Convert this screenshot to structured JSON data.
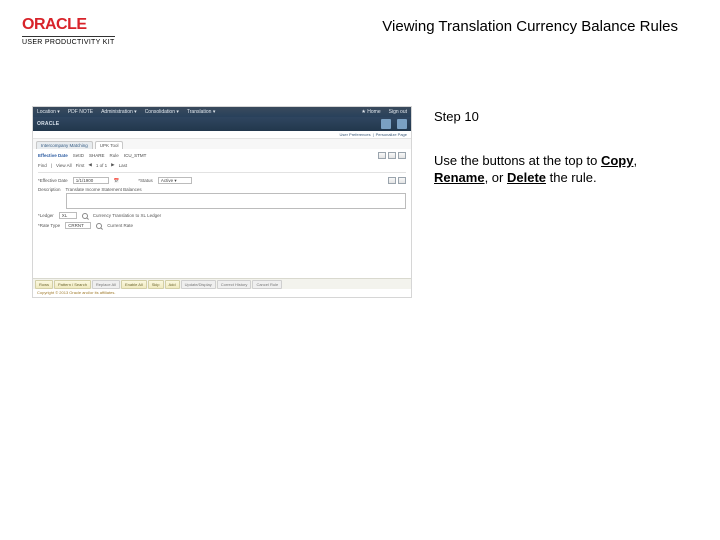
{
  "header": {
    "brand": "ORACLE",
    "subbrand": "USER PRODUCTIVITY KIT",
    "page_title": "Viewing Translation Currency Balance Rules"
  },
  "instructions": {
    "step_label": "Step 10",
    "line1_prefix": "Use the buttons at the top to ",
    "copy": "Copy",
    "comma1": ", ",
    "rename": "Rename",
    "comma2": ", or ",
    "delete": "Delete",
    "suffix": " the rule."
  },
  "shot": {
    "bar1": {
      "location_lbl": "Location ▾",
      "pdf": "PDF  NOTE",
      "admin": "Administration ▾",
      "consol": "Consolidation ▾",
      "trans": "Translation ▾",
      "home": "★ Home",
      "signout": "Sign out"
    },
    "bar2": {
      "brand": "ORACLE"
    },
    "subnav": {
      "user_prefs": "User Preferences",
      "personalize": "Personalize Page"
    },
    "tabs": {
      "t1": "Intercompany Matching",
      "t2": "UPK Tool"
    },
    "detail": {
      "effective_date": "Effective Date",
      "setid_lbl": "SetID",
      "setid_val": "SHARE",
      "rule_lbl": "Rule",
      "rule_val": "ICU_STMT",
      "find": "Find",
      "viewall": "View All",
      "first": "First",
      "pager": "1 of 1",
      "last": "Last",
      "effdate_lbl": "*Effective Date",
      "effdate_val": "1/1/1900",
      "cal_icon": "calendar-icon",
      "status_lbl": "*Status",
      "status_val": "Active ▾",
      "descr_lbl": "Description",
      "descr_val": "Translate Income Statement Balances",
      "ledger_lbl": "*Ledger",
      "ledger_val": "XL",
      "ledger_hint": "Currency Translation to XL Ledger",
      "rate_lbl": "*Rate Type",
      "rate_val": "CRRNT",
      "rate_hint": "Current Rate"
    },
    "bottom_tabs": {
      "t1": "Rows",
      "t2": "Pattern / Search",
      "t3": "Replace All",
      "t4": "Enable All",
      "t5": "Skip",
      "t6": "Add",
      "t7": "Update/Display",
      "t8": "Correct History",
      "t9": "Cancel Rule"
    },
    "footer": "Copyright © 2013 Oracle and/or its affiliates."
  }
}
